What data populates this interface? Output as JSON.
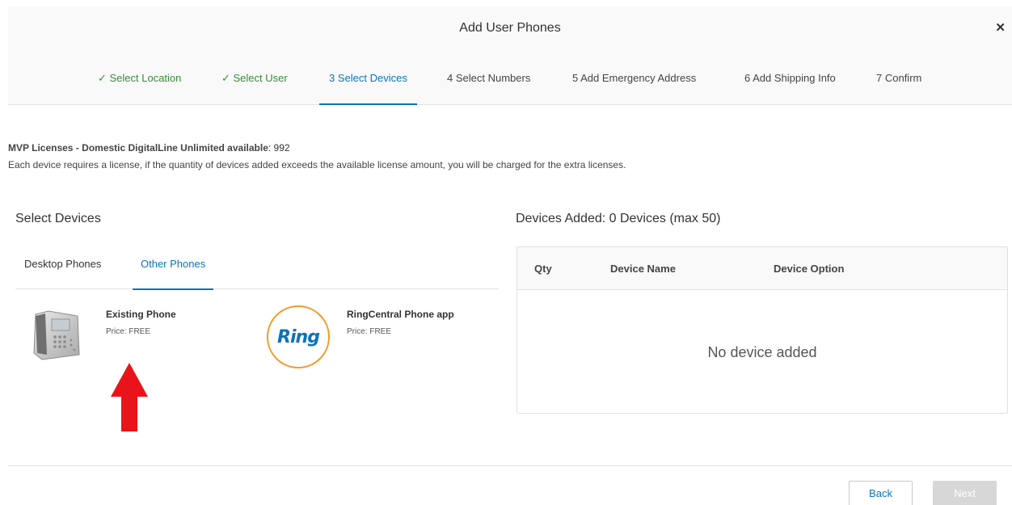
{
  "header": {
    "title": "Add User Phones",
    "close_icon": "close-icon"
  },
  "steps": [
    {
      "label": "✓ Select Location",
      "state": "done"
    },
    {
      "label": "✓ Select User",
      "state": "done"
    },
    {
      "label": "3  Select Devices",
      "state": "active"
    },
    {
      "label": "4  Select Numbers",
      "state": "todo"
    },
    {
      "label": "5  Add Emergency Address",
      "state": "todo"
    },
    {
      "label": "6  Add Shipping Info",
      "state": "todo"
    },
    {
      "label": "7  Confirm",
      "state": "todo"
    }
  ],
  "license": {
    "label": "MVP Licenses - Domestic DigitalLine Unlimited available",
    "count": ": 992",
    "note": "Each device requires a license, if the quantity of devices added exceeds the available license amount, you will be charged for the extra licenses."
  },
  "select_devices": {
    "title": "Select Devices",
    "tabs": [
      {
        "label": "Desktop Phones"
      },
      {
        "label": "Other Phones"
      }
    ],
    "devices": [
      {
        "name": "Existing Phone",
        "price": "Price: FREE",
        "icon": "desk-phone-icon"
      },
      {
        "name": "RingCentral Phone app",
        "price": "Price: FREE",
        "icon": "ring-logo-icon",
        "logo_text": "Ring"
      }
    ]
  },
  "devices_added": {
    "title": "Devices Added: 0 Devices (max 50)",
    "columns": [
      "Qty",
      "Device Name",
      "Device Option"
    ],
    "empty_text": "No device added"
  },
  "footer": {
    "back_label": "Back",
    "next_label": "Next"
  },
  "colors": {
    "accent": "#0d73b9",
    "done": "#3a8a3a",
    "ring_border": "#f39a2b",
    "arrow": "#e8141a"
  }
}
